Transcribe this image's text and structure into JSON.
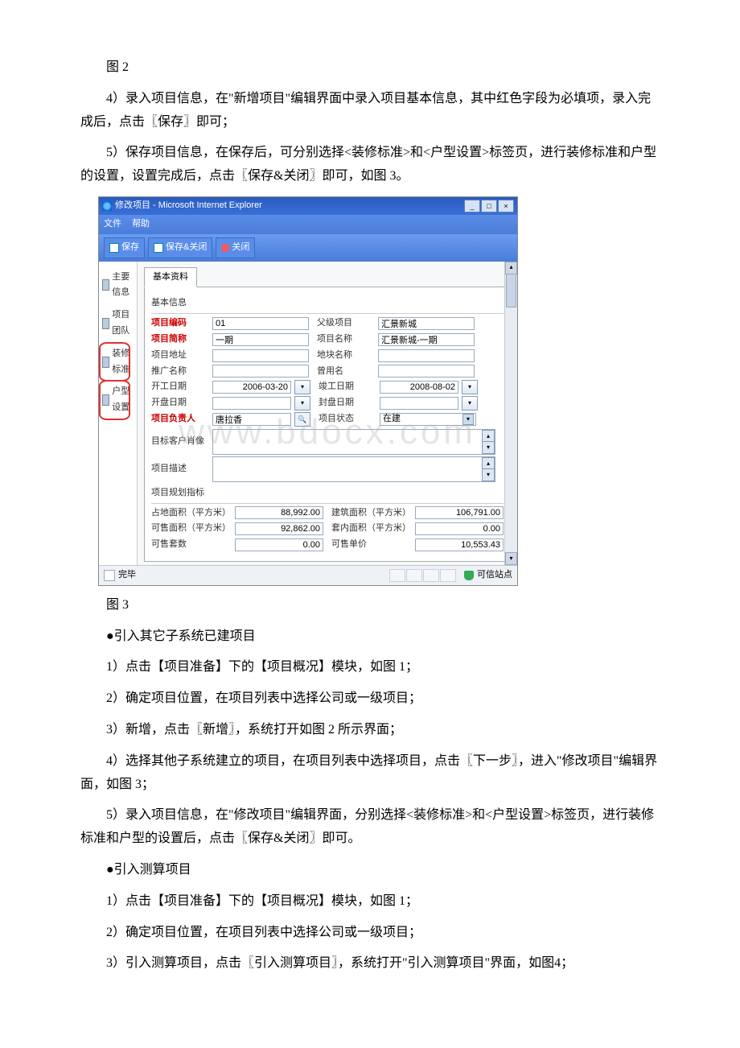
{
  "text": {
    "fig2": "图 2",
    "p4": "4）录入项目信息，在\"新增项目\"编辑界面中录入项目基本信息，其中红色字段为必填项，录入完成后，点击〖保存〗即可；",
    "p5": "5）保存项目信息，在保存后，可分别选择<装修标准>和<户型设置>标签页，进行装修标准和户型的设置，设置完成后，点击〖保存&关闭〗即可，如图 3。",
    "fig3": "图 3",
    "h_import": "●引入其它子系统已建项目",
    "imp1": "1）点击【项目准备】下的【项目概况】模块，如图 1；",
    "imp2": "2）确定项目位置，在项目列表中选择公司或一级项目；",
    "imp3": "3）新增，点击〖新增〗，系统打开如图 2 所示界面；",
    "imp4": "4）选择其他子系统建立的项目，在项目列表中选择项目，点击〖下一步〗，进入\"修改项目\"编辑界面，如图 3；",
    "imp5": "5）录入项目信息，在\"修改项目\"编辑界面，分别选择<装修标准>和<户型设置>标签页，进行装修标准和户型的设置后，点击〖保存&关闭〗即可。",
    "h_calc": "●引入测算项目",
    "calc1": "1）点击【项目准备】下的【项目概况】模块，如图 1；",
    "calc2": "2）确定项目位置，在项目列表中选择公司或一级项目；",
    "calc3": "3）引入测算项目，点击〖引入测算项目〗，系统打开\"引入测算项目\"界面，如图4；"
  },
  "window": {
    "title": "修改项目 - Microsoft Internet Explorer",
    "menu_file": "文件",
    "menu_help": "帮助",
    "btn_save": "保存",
    "btn_save_close": "保存&关闭",
    "btn_close": "关闭",
    "status_done": "完毕",
    "status_trusted": "可信站点"
  },
  "sidebar": {
    "items": [
      {
        "label": "主要信息"
      },
      {
        "label": "项目团队"
      },
      {
        "label": "装修标准"
      },
      {
        "label": "户型设置"
      }
    ]
  },
  "form": {
    "tab": "基本资料",
    "section_basic": "基本信息",
    "labels": {
      "project_code": "项目编码",
      "parent_project": "父级项目",
      "project_short": "项目简称",
      "project_name": "项目名称",
      "project_addr": "项目地址",
      "land_name": "地块名称",
      "promo_name": "推广名称",
      "old_name": "曾用名",
      "start_date": "开工日期",
      "finish_date": "竣工日期",
      "open_date": "开盘日期",
      "plan_date": "封盘日期",
      "owner": "项目负责人",
      "status": "项目状态",
      "target_customer": "目标客户肖像",
      "project_desc": "项目描述"
    },
    "values": {
      "project_code": "01",
      "parent_project": "汇景新城",
      "project_short": "一期",
      "project_name": "汇景新城-一期",
      "start_date": "2006-03-20",
      "finish_date": "2008-08-02",
      "owner": "唐拉香",
      "status": "在建"
    },
    "section_metrics": "项目规划指标",
    "metrics_labels": {
      "land_area": "占地面积（平方米）",
      "build_area": "建筑面积（平方米）",
      "sale_area": "可售面积（平方米）",
      "inner_area": "套内面积（平方米）",
      "sale_count": "可售套数",
      "sale_price": "可售单价"
    },
    "metrics_values": {
      "land_area": "88,992.00",
      "build_area": "106,791.00",
      "sale_area": "92,862.00",
      "inner_area": "0.00",
      "sale_count": "0.00",
      "sale_price": "10,553.43"
    }
  },
  "watermark": "www.bdocx.com"
}
